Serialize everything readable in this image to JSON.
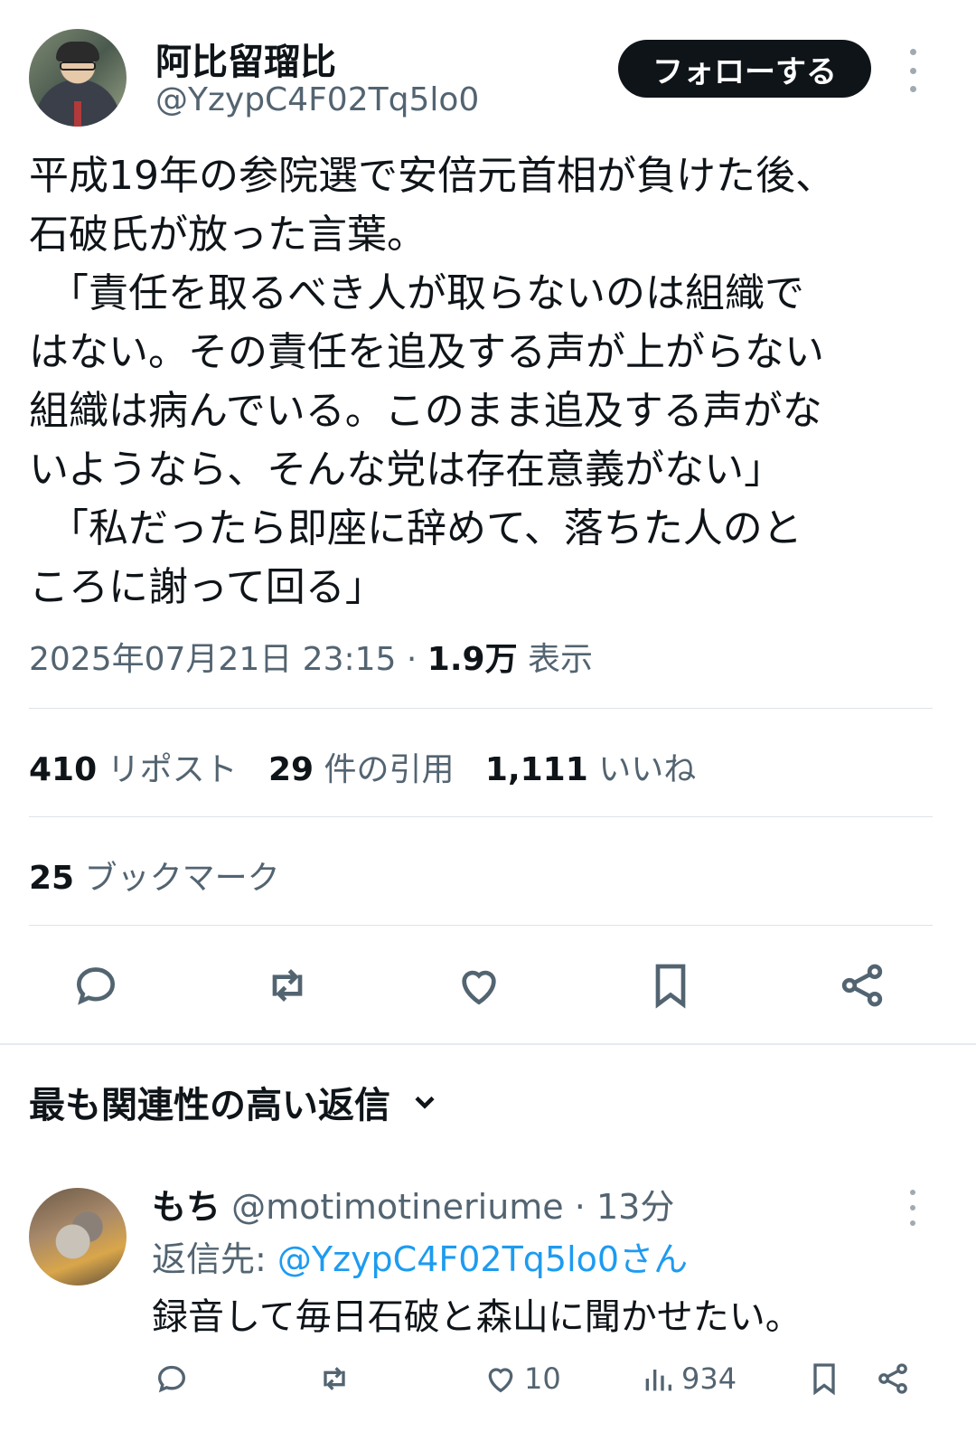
{
  "author": {
    "display_name": "阿比留瑠比",
    "handle": "@YzypC4F02Tq5lo0",
    "follow_label": "フォローする"
  },
  "tweet": {
    "lines": [
      "平成19年の参院選で安倍元首相が負けた後、",
      "石破氏が放った言葉。",
      "　「責任を取るべき人が取らないのは組織で",
      "はない。その責任を追及する声が上がらない",
      "組織は病んでいる。このまま追及する声がな",
      "いようなら、そんな党は存在意義がない」",
      "　「私だったら即座に辞めて、落ちた人のと",
      "ころに謝って回る」"
    ],
    "datetime": "2025年07月21日 23:15",
    "separator": "·",
    "views_count": "1.9万",
    "views_label": "表示"
  },
  "stats": {
    "reposts_count": "410",
    "reposts_label": "リポスト",
    "quotes_count": "29",
    "quotes_label": "件の引用",
    "likes_count": "1,111",
    "likes_label": "いいね",
    "bookmarks_count": "25",
    "bookmarks_label": "ブックマーク"
  },
  "actions": [
    "reply-icon",
    "repost-icon",
    "like-icon",
    "bookmark-icon",
    "share-icon"
  ],
  "replies_section": {
    "title": "最も関連性の高い返信"
  },
  "reply": {
    "display_name": "もち",
    "handle": "@motimotineriume",
    "separator": "·",
    "time": "13分",
    "reply_to_label": "返信先:",
    "reply_to_handle": "@YzypC4F02Tq5lo0さん",
    "text": "録音して毎日石破と森山に聞かせたい。",
    "likes": "10",
    "views": "934"
  },
  "colors": {
    "text_primary": "#0f1419",
    "text_secondary": "#536471",
    "link": "#1d9bf0",
    "divider": "#dfe3e6"
  }
}
